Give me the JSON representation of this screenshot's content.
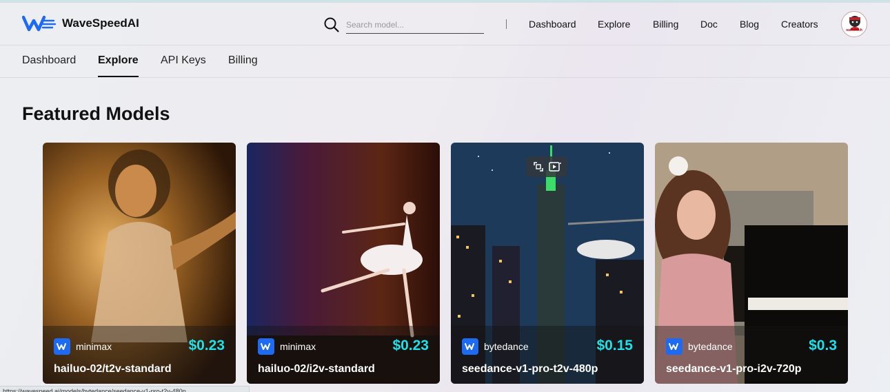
{
  "brand": {
    "name": "WaveSpeedAI",
    "logo_icon": "wave-logo-icon"
  },
  "search": {
    "placeholder": "Search model...",
    "value": ""
  },
  "top_nav": [
    "Dashboard",
    "Explore",
    "Billing",
    "Doc",
    "Blog",
    "Creators"
  ],
  "user": {
    "avatar_label": "sumotech"
  },
  "sub_nav": {
    "tabs": [
      "Dashboard",
      "Explore",
      "API Keys",
      "Billing"
    ],
    "active": "Explore"
  },
  "section_title": "Featured Models",
  "cards": [
    {
      "provider": "minimax",
      "price": "$0.23",
      "name": "hailuo-02/t2v-standard"
    },
    {
      "provider": "minimax",
      "price": "$0.23",
      "name": "hailuo-02/i2v-standard"
    },
    {
      "provider": "bytedance",
      "price": "$0.15",
      "name": "seedance-v1-pro-t2v-480p"
    },
    {
      "provider": "bytedance",
      "price": "$0.3",
      "name": "seedance-v1-pro-i2v-720p"
    }
  ],
  "status_url": "https://wavespeed.ai/models/bytedance/seedance-v1-pro-t2v-480p",
  "colors": {
    "price": "#1fe0e8",
    "brand_blue": "#1e6af0",
    "accent_border": "#111111"
  }
}
